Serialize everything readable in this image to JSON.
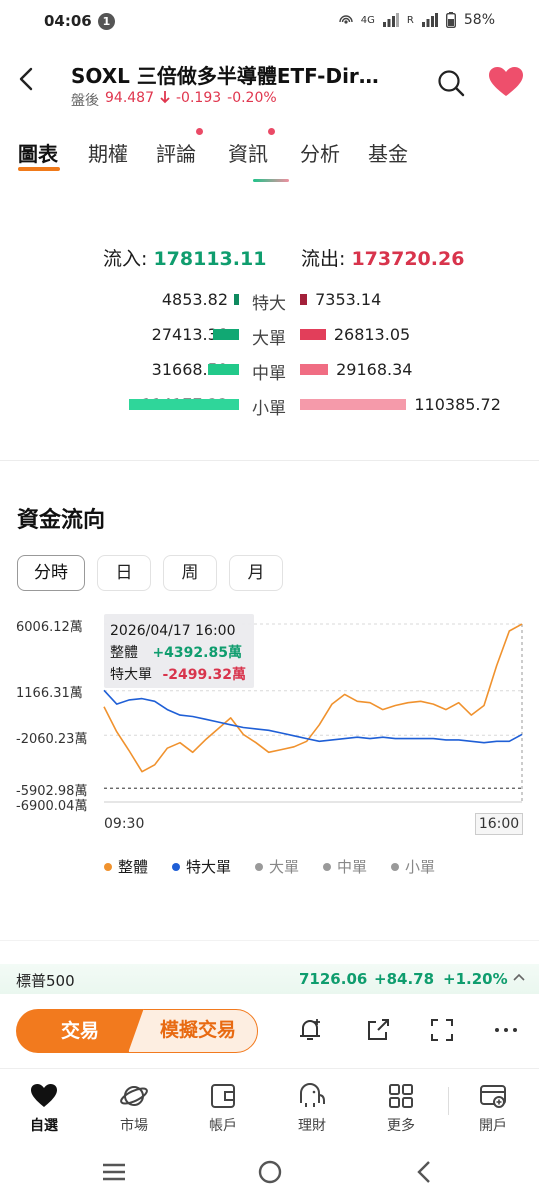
{
  "status_bar": {
    "time": "04:06",
    "notification_count": "1",
    "network": "4G",
    "roaming": "R",
    "battery": "58%"
  },
  "header": {
    "title": "SOXL  三倍做多半導體ETF-Dir…",
    "session_label": "盤後",
    "price": "94.487",
    "change": "-0.193",
    "change_pct": "-0.20%"
  },
  "tabs": [
    {
      "label": "圖表",
      "active": true,
      "dot": false
    },
    {
      "label": "期權",
      "active": false,
      "dot": false
    },
    {
      "label": "評論",
      "active": false,
      "dot": true
    },
    {
      "label": "資訊",
      "active": false,
      "dot": true
    },
    {
      "label": "分析",
      "active": false,
      "dot": false
    },
    {
      "label": "基金",
      "active": false,
      "dot": false
    }
  ],
  "flow_summary": {
    "inflow_label": "流入:",
    "inflow_value": "178113.11",
    "outflow_label": "流出:",
    "outflow_value": "173720.26"
  },
  "order_sizes": [
    {
      "label": "特大",
      "inflow": "4853.82",
      "outflow": "7353.14",
      "inflow_num": 4853.82,
      "outflow_num": 7353.14,
      "in_color": "#0f8a5f",
      "out_color": "#a3203a"
    },
    {
      "label": "大單",
      "inflow": "27413.38",
      "outflow": "26813.05",
      "inflow_num": 27413.38,
      "outflow_num": 26813.05,
      "in_color": "#11a873",
      "out_color": "#e23e5a"
    },
    {
      "label": "中單",
      "inflow": "31668.59",
      "outflow": "29168.34",
      "inflow_num": 31668.59,
      "outflow_num": 29168.34,
      "in_color": "#22c98a",
      "out_color": "#f06d83"
    },
    {
      "label": "小單",
      "inflow": "114177.33",
      "outflow": "110385.72",
      "inflow_num": 114177.33,
      "outflow_num": 110385.72,
      "in_color": "#2fd69a",
      "out_color": "#f59aaa"
    }
  ],
  "capital_flow": {
    "title": "資金流向",
    "periods": [
      "分時",
      "日",
      "周",
      "月"
    ],
    "active_period": "分時"
  },
  "chart_data": {
    "type": "line",
    "y_tick_labels": [
      "6006.12萬",
      "1166.31萬",
      "-2060.23萬",
      "-5902.98萬",
      "-6900.04萬"
    ],
    "ylim": [
      -6900.04,
      6006.12
    ],
    "x_tick_labels": [
      "09:30",
      "16:00"
    ],
    "tooltip": {
      "datetime": "2026/04/17 16:00",
      "overall_label": "整體",
      "overall_value": "+4392.85萬",
      "xl_label": "特大單",
      "xl_value": "-2499.32萬"
    },
    "series": [
      {
        "name": "整體",
        "color": "#f0922e",
        "values": [
          0,
          -1800,
          -3200,
          -4700,
          -4200,
          -3000,
          -2600,
          -3300,
          -2400,
          -1600,
          -800,
          -2000,
          -2600,
          -3300,
          -3100,
          -2900,
          -2500,
          -1300,
          200,
          900,
          400,
          300,
          -200,
          100,
          300,
          400,
          200,
          -200,
          300,
          -600,
          100,
          3000,
          5500,
          6000
        ]
      },
      {
        "name": "特大單",
        "color": "#1f5fd6",
        "values": [
          1200,
          200,
          500,
          600,
          400,
          -200,
          -600,
          -700,
          -900,
          -1100,
          -1300,
          -1500,
          -1600,
          -1700,
          -1900,
          -2100,
          -2300,
          -2500,
          -2400,
          -2300,
          -2200,
          -2300,
          -2200,
          -2300,
          -2300,
          -2300,
          -2300,
          -2400,
          -2400,
          -2500,
          -2600,
          -2500,
          -2500,
          -2000
        ]
      }
    ],
    "legend": [
      {
        "name": "整體",
        "color": "#f0922e",
        "muted": false
      },
      {
        "name": "特大單",
        "color": "#1f5fd6",
        "muted": false
      },
      {
        "name": "大單",
        "color": "#9a9a9a",
        "muted": true
      },
      {
        "name": "中單",
        "color": "#9a9a9a",
        "muted": true
      },
      {
        "name": "小單",
        "color": "#9a9a9a",
        "muted": true
      }
    ]
  },
  "index_ticker": {
    "name": "標普500",
    "price": "7126.06",
    "change": "+84.78",
    "change_pct": "+1.20%"
  },
  "action_bar": {
    "trade_label": "交易",
    "sim_trade_label": "模擬交易"
  },
  "bottom_nav": [
    {
      "label": "自選",
      "icon": "heart-icon",
      "active": true
    },
    {
      "label": "市場",
      "icon": "planet-icon",
      "active": false
    },
    {
      "label": "帳戶",
      "icon": "wallet-icon",
      "active": false
    },
    {
      "label": "理財",
      "icon": "elephant-icon",
      "active": false
    },
    {
      "label": "更多",
      "icon": "grid-icon",
      "active": false
    },
    {
      "label": "開戶",
      "icon": "open-account-icon",
      "active": false
    }
  ]
}
